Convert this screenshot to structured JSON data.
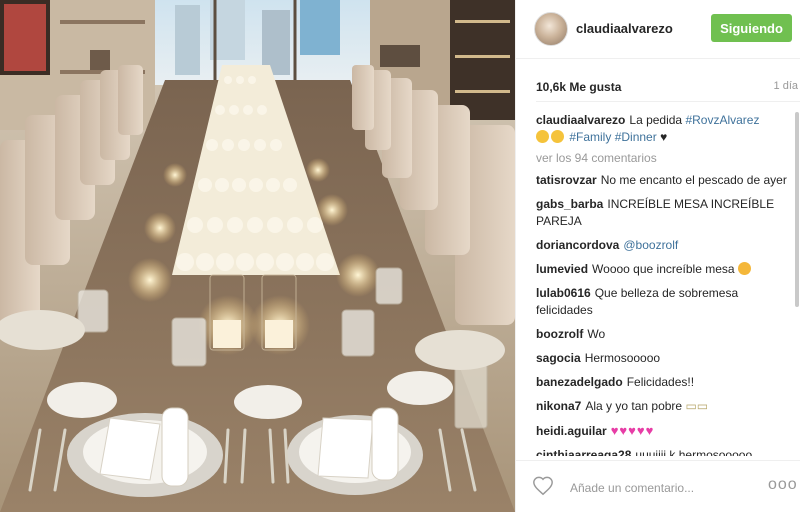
{
  "post": {
    "image_description_icon": "photo",
    "username": "claudiaalvarezo",
    "follow_label": "Siguiendo",
    "likes": "10,6k Me gusta",
    "time": "1 día",
    "caption": {
      "username": "claudiaalvarezo",
      "text": "La pedida",
      "tags": [
        "#RovzAlvarez",
        "#Family",
        "#Dinner"
      ],
      "heart": "♥"
    },
    "view_comments": "ver los 94 comentarios",
    "comments": [
      {
        "user": "tatisrovzar",
        "text": "No me encanto el pescado de ayer"
      },
      {
        "user": "gabs_barba",
        "text": "INCREÍBLE MESA INCREÍBLE PAREJA"
      },
      {
        "user": "doriancordova",
        "text": "@boozrolf"
      },
      {
        "user": "lumevied",
        "text": "Woooo que increíble mesa"
      },
      {
        "user": "lulab0616",
        "text": "Que belleza de sobremesa felicidades"
      },
      {
        "user": "boozrolf",
        "text": "Wo"
      },
      {
        "user": "sagocia",
        "text": "Hermosooooo"
      },
      {
        "user": "banezadelgado",
        "text": "Felicidades!!"
      },
      {
        "user": "nikona7",
        "text": "Ala y yo tan pobre"
      },
      {
        "user": "heidi.aguilar",
        "text": ""
      },
      {
        "user": "cinthiaarreaga28",
        "text": "uuuiiii k hermosooooo"
      }
    ],
    "comment_placeholder": "Añade un comentario...",
    "more_label": "ooo",
    "colors": {
      "follow_button": "#70c050",
      "hashtag": "#3f729b",
      "text": "#262626",
      "muted": "#999999"
    }
  }
}
